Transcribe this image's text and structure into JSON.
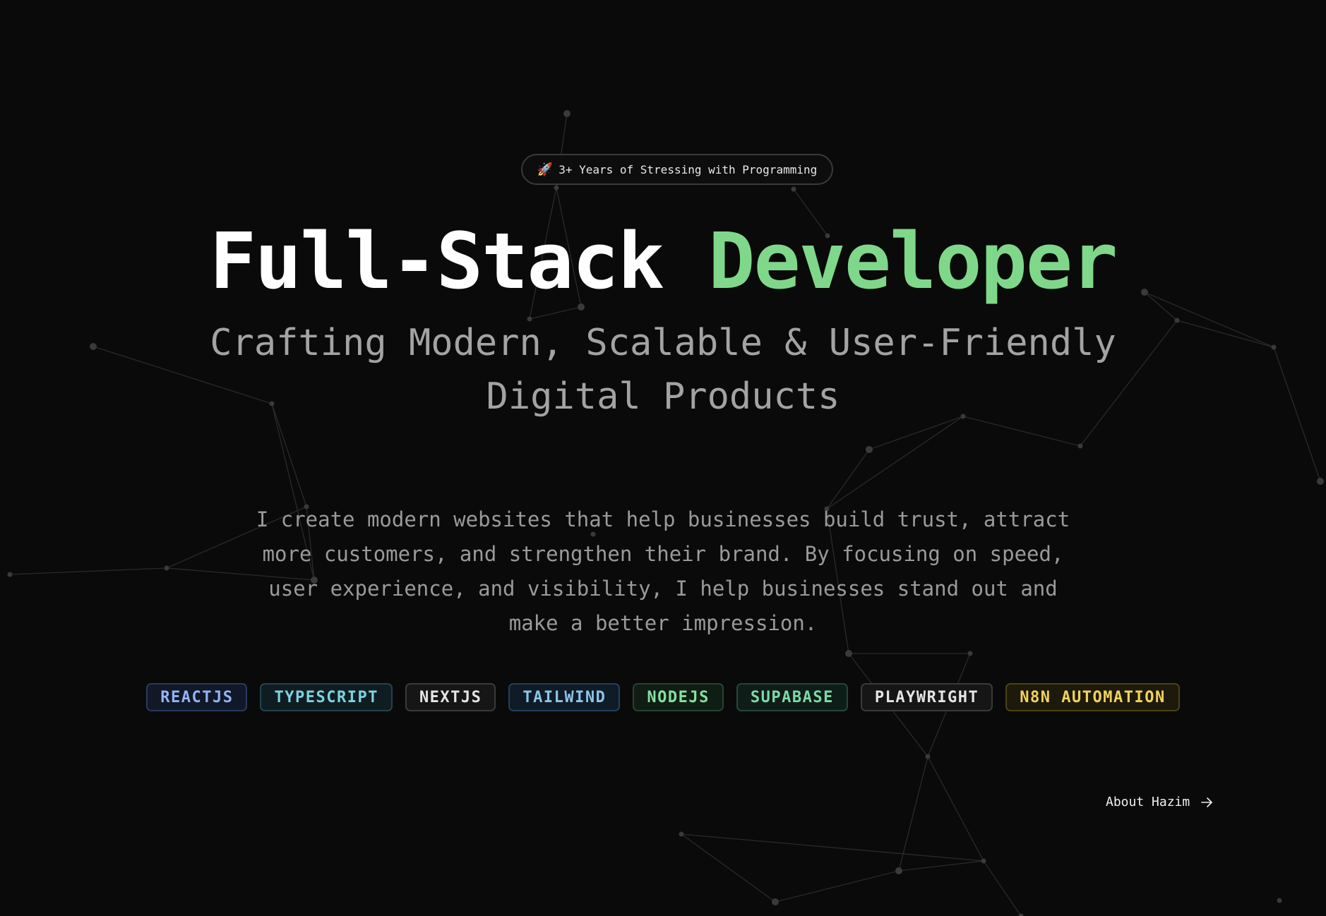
{
  "badge": {
    "icon": "rocket-icon",
    "emoji": "🚀",
    "text": "3+ Years of Stressing with Programming"
  },
  "title": {
    "part1": "Full-Stack",
    "part2": "Developer",
    "accent_color": "#7fd88a"
  },
  "subtitle": {
    "line1": "Crafting Modern, Scalable & User-Friendly",
    "line2": "Digital Products"
  },
  "description": {
    "line1": "I create modern websites that help businesses build trust, attract",
    "line2": "more customers, and strengthen their brand. By focusing on speed,",
    "line3": "user experience, and visibility, I help businesses stand out and",
    "line4": "make a better impression."
  },
  "tags": [
    {
      "label": "REACTJS",
      "color": "#93b4f5",
      "border": "#2b3a5c",
      "bg": "#111827"
    },
    {
      "label": "TYPESCRIPT",
      "color": "#7dd3e0",
      "border": "#23434d",
      "bg": "#0f1d22"
    },
    {
      "label": "NEXTJS",
      "color": "#e5e5e5",
      "border": "#3a3a3a",
      "bg": "#161616"
    },
    {
      "label": "TAILWIND",
      "color": "#8cc4ea",
      "border": "#23405a",
      "bg": "#0f1b26"
    },
    {
      "label": "NODEJS",
      "color": "#86e0a0",
      "border": "#24452e",
      "bg": "#0f1d14"
    },
    {
      "label": "SUPABASE",
      "color": "#7ed9a8",
      "border": "#24473a",
      "bg": "#0f1d18"
    },
    {
      "label": "PLAYWRIGHT",
      "color": "#e5e5e5",
      "border": "#3a3a3a",
      "bg": "#161616"
    },
    {
      "label": "N8N AUTOMATION",
      "color": "#f0d35c",
      "border": "#4d4218",
      "bg": "#1d190b"
    }
  ],
  "about_link": {
    "label": "About Hazim",
    "icon": "arrow-right-icon"
  }
}
